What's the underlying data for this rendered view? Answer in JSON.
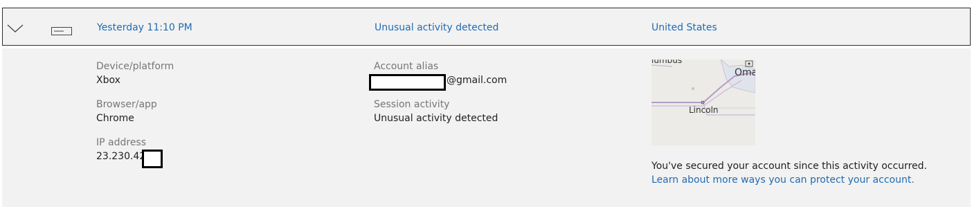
{
  "header": {
    "time": "Yesterday 11:10 PM",
    "activity": "Unusual activity detected",
    "location": "United States"
  },
  "details": {
    "device_label": "Device/platform",
    "device_value": "Xbox",
    "browser_label": "Browser/app",
    "browser_value": "Chrome",
    "ip_label": "IP address",
    "ip_value": "23.230.42.",
    "alias_label": "Account alias",
    "alias_value": "@gmail.com",
    "session_label": "Session activity",
    "session_value": "Unusual activity detected"
  },
  "map": {
    "labels": [
      "lumbus",
      "Omah",
      "Lincoln"
    ]
  },
  "notice": {
    "secured_text": "You've secured your account since this activity occurred.",
    "learn_link": "Learn about more ways you can protect your account."
  },
  "icons": {
    "expand": "chevron-down-icon",
    "device": "device-console-icon"
  }
}
